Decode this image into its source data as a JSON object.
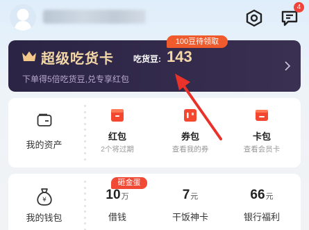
{
  "header": {
    "message_badge": "4",
    "icons": {
      "settings": "hexagon-settings-icon",
      "message": "chat-bubble-icon"
    }
  },
  "super_card": {
    "title": "超级吃货卡",
    "bean_label": "吃货豆:",
    "bean_value": "143",
    "subtitle": "下单得5倍吃货豆,兑专享红包",
    "pending_tag": "100豆待领取",
    "accent_color": "#f4d7a6"
  },
  "assets": {
    "label": "我的资产",
    "items": [
      {
        "name": "红包",
        "desc": "2个将过期"
      },
      {
        "name": "券包",
        "desc": "查看我的券"
      },
      {
        "name": "卡包",
        "desc": "查看会员卡"
      }
    ]
  },
  "wallet": {
    "label": "我的钱包",
    "hot_tag": "砸金蛋",
    "items": [
      {
        "value": "10",
        "unit": "万",
        "name": "借钱"
      },
      {
        "value": "7",
        "unit": "元",
        "name": "干饭神卡"
      },
      {
        "value": "66",
        "unit": "元",
        "name": "银行福利"
      }
    ]
  },
  "colors": {
    "brand_red": "#f0443a",
    "card_dark": "#2b2444"
  }
}
